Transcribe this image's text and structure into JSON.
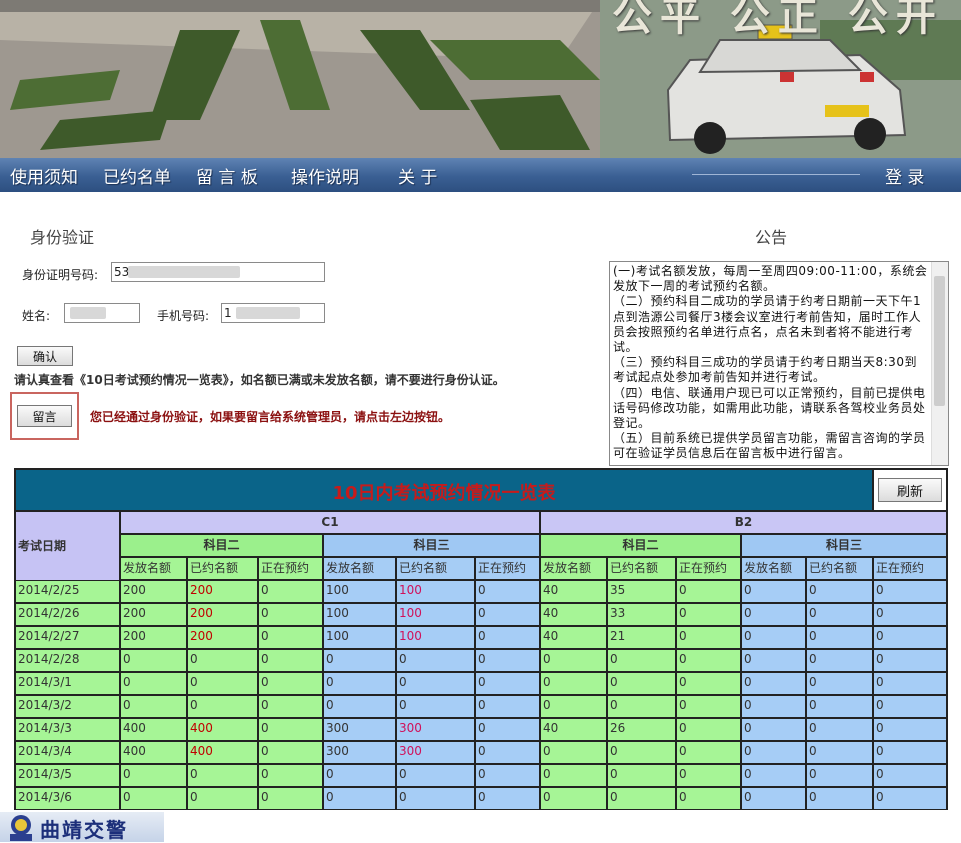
{
  "banner": {
    "title": "公平 公正 公开"
  },
  "nav": {
    "items": [
      "使用须知",
      "已约名单",
      "留 言 板",
      "操作说明",
      "关  于"
    ],
    "login": "登 录"
  },
  "identity": {
    "title": "身份验证",
    "id_label": "身份证明号码:",
    "id_value": "53",
    "name_label": "姓名:",
    "phone_label": "手机号码:",
    "phone_value": "1",
    "confirm": "确认",
    "notice": "请认真查看《10日考试预约情况一览表》，如名额已满或未发放名额，请不要进行身份认证。",
    "message_button": "留言",
    "message_hint": "您已经通过身份验证，如果要留言给系统管理员，请点击左边按钮。"
  },
  "announcement": {
    "title": "公告",
    "text": "(一)考试名额发放，每周一至周四09:00-11:00，系统会发放下一周的考试预约名额。\n（二）预约科目二成功的学员请于约考日期前一天下午1点到浩源公司餐厅3楼会议室进行考前告知，届时工作人员会按照预约名单进行点名，点名未到者将不能进行考试。\n（三）预约科目三成功的学员请于约考日期当天8:30到考试起点处参加考前告知并进行考试。\n（四）电信、联通用户现已可以正常预约，目前已提供电话号码修改功能，如需用此功能，请联系各驾校业务员处登记。\n（五）目前系统已提供学员留言功能，需留言咨询的学员可在验证学员信息后在留言板中进行留言。"
  },
  "table": {
    "title": "10日内考试预约情况一览表",
    "refresh": "刷新",
    "date_header": "考试日期",
    "licenses": [
      "C1",
      "B2"
    ],
    "subjects": [
      "科目二",
      "科目三",
      "科目二",
      "科目三"
    ],
    "columns": [
      "发放名额",
      "已约名额",
      "正在预约",
      "发放名额",
      "已约名额",
      "正在预约",
      "发放名额",
      "已约名额",
      "正在预约",
      "发放名额",
      "已约名额",
      "正在预约"
    ],
    "rows": [
      {
        "date": "2014/2/25",
        "v": [
          "200",
          "200",
          "0",
          "100",
          "100",
          "0",
          "40",
          "35",
          "0",
          "0",
          "0",
          "0"
        ]
      },
      {
        "date": "2014/2/26",
        "v": [
          "200",
          "200",
          "0",
          "100",
          "100",
          "0",
          "40",
          "33",
          "0",
          "0",
          "0",
          "0"
        ]
      },
      {
        "date": "2014/2/27",
        "v": [
          "200",
          "200",
          "0",
          "100",
          "100",
          "0",
          "40",
          "21",
          "0",
          "0",
          "0",
          "0"
        ]
      },
      {
        "date": "2014/2/28",
        "v": [
          "0",
          "0",
          "0",
          "0",
          "0",
          "0",
          "0",
          "0",
          "0",
          "0",
          "0",
          "0"
        ]
      },
      {
        "date": "2014/3/1",
        "v": [
          "0",
          "0",
          "0",
          "0",
          "0",
          "0",
          "0",
          "0",
          "0",
          "0",
          "0",
          "0"
        ]
      },
      {
        "date": "2014/3/2",
        "v": [
          "0",
          "0",
          "0",
          "0",
          "0",
          "0",
          "0",
          "0",
          "0",
          "0",
          "0",
          "0"
        ]
      },
      {
        "date": "2014/3/3",
        "v": [
          "400",
          "400",
          "0",
          "300",
          "300",
          "0",
          "40",
          "26",
          "0",
          "0",
          "0",
          "0"
        ]
      },
      {
        "date": "2014/3/4",
        "v": [
          "400",
          "400",
          "0",
          "300",
          "300",
          "0",
          "0",
          "0",
          "0",
          "0",
          "0",
          "0"
        ]
      },
      {
        "date": "2014/3/5",
        "v": [
          "0",
          "0",
          "0",
          "0",
          "0",
          "0",
          "0",
          "0",
          "0",
          "0",
          "0",
          "0"
        ]
      },
      {
        "date": "2014/3/6",
        "v": [
          "0",
          "0",
          "0",
          "0",
          "0",
          "0",
          "0",
          "0",
          "0",
          "0",
          "0",
          "0"
        ]
      }
    ]
  },
  "footer": {
    "logo_text": "曲靖交警"
  },
  "colors": {
    "nav": "#3a5f93",
    "title_bar": "#0a6489",
    "title_text": "#c71b1b",
    "green": "#a6f596",
    "blue": "#a6cdf6"
  }
}
